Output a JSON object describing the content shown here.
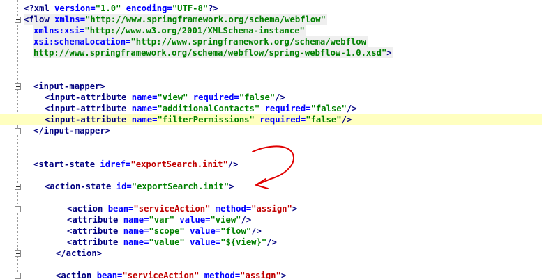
{
  "editor": {
    "lines": [
      {
        "indent": 34,
        "segments": [
          {
            "t": "<?",
            "c": "tag"
          },
          {
            "t": "xml ",
            "c": "tag"
          },
          {
            "t": "version=",
            "c": "attr"
          },
          {
            "t": "\"1.0\"",
            "c": "val"
          },
          {
            "t": " encoding=",
            "c": "attr"
          },
          {
            "t": "\"UTF-8\"",
            "c": "val"
          },
          {
            "t": "?>",
            "c": "tag"
          }
        ]
      },
      {
        "indent": 34,
        "bg": true,
        "fold": "start",
        "segments": [
          {
            "t": "<flow ",
            "c": "tag"
          },
          {
            "t": "xmlns=",
            "c": "attr"
          },
          {
            "t": "\"http://www.springframework.org/schema/webflow\"",
            "c": "val"
          }
        ]
      },
      {
        "indent": 48,
        "bg": true,
        "segments": [
          {
            "t": "xmlns:xsi=",
            "c": "attr"
          },
          {
            "t": "\"http://www.w3.org/2001/XMLSchema-instance\"",
            "c": "val"
          }
        ]
      },
      {
        "indent": 48,
        "bg": true,
        "segments": [
          {
            "t": "xsi:schemaLocation=",
            "c": "attr"
          },
          {
            "t": "\"http://www.springframework.org/schema/webflow",
            "c": "val"
          }
        ]
      },
      {
        "indent": 48,
        "bg": true,
        "segments": [
          {
            "t": "http://www.springframework.org/schema/webflow/spring-webflow-1.0.xsd\"",
            "c": "val"
          },
          {
            "t": ">",
            "c": "tag"
          }
        ]
      },
      {
        "indent": 34,
        "segments": []
      },
      {
        "indent": 34,
        "segments": []
      },
      {
        "indent": 48,
        "fold": "start",
        "segments": [
          {
            "t": "<input-mapper>",
            "c": "tag"
          }
        ]
      },
      {
        "indent": 64,
        "segments": [
          {
            "t": "<input-attribute ",
            "c": "tag"
          },
          {
            "t": "name=",
            "c": "attr"
          },
          {
            "t": "\"view\"",
            "c": "val"
          },
          {
            "t": " required=",
            "c": "attr"
          },
          {
            "t": "\"false\"",
            "c": "val"
          },
          {
            "t": "/>",
            "c": "tag"
          }
        ]
      },
      {
        "indent": 64,
        "segments": [
          {
            "t": "<input-attribute ",
            "c": "tag"
          },
          {
            "t": "name=",
            "c": "attr"
          },
          {
            "t": "\"additionalContacts\"",
            "c": "val"
          },
          {
            "t": " required=",
            "c": "attr"
          },
          {
            "t": "\"false\"",
            "c": "val"
          },
          {
            "t": "/>",
            "c": "tag"
          }
        ]
      },
      {
        "indent": 64,
        "highlight": true,
        "segments": [
          {
            "t": "<input-attribute ",
            "c": "tag"
          },
          {
            "t": "name=",
            "c": "attr"
          },
          {
            "t": "\"filterPermissions\"",
            "c": "val"
          },
          {
            "t": " required=",
            "c": "attr"
          },
          {
            "t": "\"false\"",
            "c": "val"
          },
          {
            "t": "/>",
            "c": "tag"
          }
        ]
      },
      {
        "indent": 48,
        "fold": "end",
        "segments": [
          {
            "t": "</input-mapper>",
            "c": "tag"
          }
        ]
      },
      {
        "indent": 34,
        "segments": []
      },
      {
        "indent": 34,
        "segments": []
      },
      {
        "indent": 48,
        "segments": [
          {
            "t": "<start-state ",
            "c": "tag"
          },
          {
            "t": "idref=",
            "c": "attr"
          },
          {
            "t": "\"exportSearch.init\"",
            "c": "val-red"
          },
          {
            "t": "/>",
            "c": "tag"
          }
        ]
      },
      {
        "indent": 34,
        "segments": []
      },
      {
        "indent": 64,
        "fold": "start",
        "segments": [
          {
            "t": "<action-state ",
            "c": "tag"
          },
          {
            "t": "id=",
            "c": "attr"
          },
          {
            "t": "\"exportSearch.init\"",
            "c": "val"
          },
          {
            "t": ">",
            "c": "tag"
          }
        ]
      },
      {
        "indent": 34,
        "segments": []
      },
      {
        "indent": 96,
        "fold": "start",
        "segments": [
          {
            "t": "<action ",
            "c": "tag"
          },
          {
            "t": "bean=",
            "c": "attr"
          },
          {
            "t": "\"serviceAction\"",
            "c": "val-red"
          },
          {
            "t": " method=",
            "c": "attr"
          },
          {
            "t": "\"assign\"",
            "c": "val-red"
          },
          {
            "t": ">",
            "c": "tag"
          }
        ]
      },
      {
        "indent": 96,
        "segments": [
          {
            "t": "<attribute ",
            "c": "tag"
          },
          {
            "t": "name=",
            "c": "attr"
          },
          {
            "t": "\"var\"",
            "c": "val"
          },
          {
            "t": " value=",
            "c": "attr"
          },
          {
            "t": "\"view\"",
            "c": "val"
          },
          {
            "t": "/>",
            "c": "tag"
          }
        ]
      },
      {
        "indent": 96,
        "segments": [
          {
            "t": "<attribute ",
            "c": "tag"
          },
          {
            "t": "name=",
            "c": "attr"
          },
          {
            "t": "\"scope\"",
            "c": "val"
          },
          {
            "t": " value=",
            "c": "attr"
          },
          {
            "t": "\"flow\"",
            "c": "val"
          },
          {
            "t": "/>",
            "c": "tag"
          }
        ]
      },
      {
        "indent": 96,
        "segments": [
          {
            "t": "<attribute ",
            "c": "tag"
          },
          {
            "t": "name=",
            "c": "attr"
          },
          {
            "t": "\"value\"",
            "c": "val"
          },
          {
            "t": " value=",
            "c": "attr"
          },
          {
            "t": "\"${view}\"",
            "c": "val"
          },
          {
            "t": "/>",
            "c": "tag"
          }
        ]
      },
      {
        "indent": 80,
        "fold": "end",
        "segments": [
          {
            "t": "</action>",
            "c": "tag"
          }
        ]
      },
      {
        "indent": 34,
        "segments": []
      },
      {
        "indent": 80,
        "fold": "start",
        "segments": [
          {
            "t": "<action ",
            "c": "tag"
          },
          {
            "t": "bean=",
            "c": "attr"
          },
          {
            "t": "\"serviceAction\"",
            "c": "val-red"
          },
          {
            "t": " method=",
            "c": "attr"
          },
          {
            "t": "\"assign\"",
            "c": "val-red"
          },
          {
            "t": ">",
            "c": "tag"
          }
        ]
      }
    ]
  },
  "colors": {
    "tag": "#000080",
    "attribute": "#0000ff",
    "value": "#008000",
    "value_red": "#c00000",
    "highlight_line": "#ffffc0",
    "annotation": "#e00000"
  }
}
